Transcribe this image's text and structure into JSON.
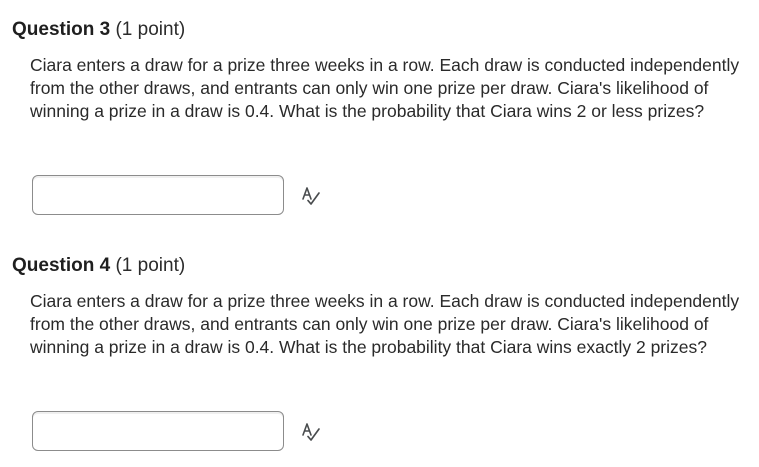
{
  "questions": [
    {
      "title": "Question 3",
      "points": "(1 point)",
      "text": "Ciara enters a draw for a prize three weeks in a row. Each draw is conducted independently from the other draws, and entrants can only win one prize per draw. Ciara's likelihood of winning a prize in a draw is 0.4. What is the probability that Ciara wins 2 or less prizes?",
      "answer_value": "",
      "icon": "spell-check-icon"
    },
    {
      "title": "Question 4",
      "points": "(1 point)",
      "text": "Ciara enters a draw for a prize three weeks in a row. Each draw is conducted independently from the other draws, and entrants can only win one prize per draw. Ciara's likelihood of winning a prize in a draw is 0.4. What is the probability that Ciara wins exactly 2 prizes?",
      "answer_value": "",
      "icon": "spell-check-icon"
    }
  ]
}
